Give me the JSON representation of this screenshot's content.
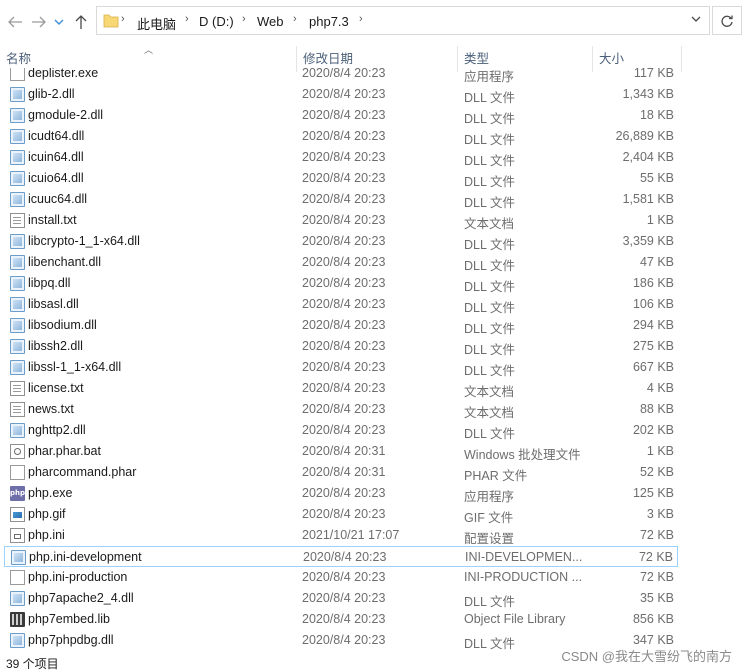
{
  "nav": {
    "breadcrumb": [
      "此电脑",
      "D (D:)",
      "Web",
      "php7.3"
    ]
  },
  "columns": {
    "name": "名称",
    "date": "修改日期",
    "type": "类型",
    "size": "大小"
  },
  "files": [
    {
      "name": "deplister.exe",
      "date": "2020/8/4 20:23",
      "type": "应用程序",
      "size": "117 KB",
      "icon": "exe-icon"
    },
    {
      "name": "glib-2.dll",
      "date": "2020/8/4 20:23",
      "type": "DLL 文件",
      "size": "1,343 KB",
      "icon": "dll-icon"
    },
    {
      "name": "gmodule-2.dll",
      "date": "2020/8/4 20:23",
      "type": "DLL 文件",
      "size": "18 KB",
      "icon": "dll-icon"
    },
    {
      "name": "icudt64.dll",
      "date": "2020/8/4 20:23",
      "type": "DLL 文件",
      "size": "26,889 KB",
      "icon": "dll-icon"
    },
    {
      "name": "icuin64.dll",
      "date": "2020/8/4 20:23",
      "type": "DLL 文件",
      "size": "2,404 KB",
      "icon": "dll-icon"
    },
    {
      "name": "icuio64.dll",
      "date": "2020/8/4 20:23",
      "type": "DLL 文件",
      "size": "55 KB",
      "icon": "dll-icon"
    },
    {
      "name": "icuuc64.dll",
      "date": "2020/8/4 20:23",
      "type": "DLL 文件",
      "size": "1,581 KB",
      "icon": "dll-icon"
    },
    {
      "name": "install.txt",
      "date": "2020/8/4 20:23",
      "type": "文本文档",
      "size": "1 KB",
      "icon": "text-file-icon"
    },
    {
      "name": "libcrypto-1_1-x64.dll",
      "date": "2020/8/4 20:23",
      "type": "DLL 文件",
      "size": "3,359 KB",
      "icon": "dll-icon"
    },
    {
      "name": "libenchant.dll",
      "date": "2020/8/4 20:23",
      "type": "DLL 文件",
      "size": "47 KB",
      "icon": "dll-icon"
    },
    {
      "name": "libpq.dll",
      "date": "2020/8/4 20:23",
      "type": "DLL 文件",
      "size": "186 KB",
      "icon": "dll-icon"
    },
    {
      "name": "libsasl.dll",
      "date": "2020/8/4 20:23",
      "type": "DLL 文件",
      "size": "106 KB",
      "icon": "dll-icon"
    },
    {
      "name": "libsodium.dll",
      "date": "2020/8/4 20:23",
      "type": "DLL 文件",
      "size": "294 KB",
      "icon": "dll-icon"
    },
    {
      "name": "libssh2.dll",
      "date": "2020/8/4 20:23",
      "type": "DLL 文件",
      "size": "275 KB",
      "icon": "dll-icon"
    },
    {
      "name": "libssl-1_1-x64.dll",
      "date": "2020/8/4 20:23",
      "type": "DLL 文件",
      "size": "667 KB",
      "icon": "dll-icon"
    },
    {
      "name": "license.txt",
      "date": "2020/8/4 20:23",
      "type": "文本文档",
      "size": "4 KB",
      "icon": "text-file-icon"
    },
    {
      "name": "news.txt",
      "date": "2020/8/4 20:23",
      "type": "文本文档",
      "size": "88 KB",
      "icon": "text-file-icon"
    },
    {
      "name": "nghttp2.dll",
      "date": "2020/8/4 20:23",
      "type": "DLL 文件",
      "size": "202 KB",
      "icon": "dll-icon"
    },
    {
      "name": "phar.phar.bat",
      "date": "2020/8/4 20:31",
      "type": "Windows 批处理文件",
      "size": "1 KB",
      "icon": "batch-file-icon"
    },
    {
      "name": "pharcommand.phar",
      "date": "2020/8/4 20:31",
      "type": "PHAR 文件",
      "size": "52 KB",
      "icon": "blank-file-icon"
    },
    {
      "name": "php.exe",
      "date": "2020/8/4 20:23",
      "type": "应用程序",
      "size": "125 KB",
      "icon": "php-exe-icon"
    },
    {
      "name": "php.gif",
      "date": "2020/8/4 20:23",
      "type": "GIF 文件",
      "size": "3 KB",
      "icon": "image-file-icon"
    },
    {
      "name": "php.ini",
      "date": "2021/10/21 17:07",
      "type": "配置设置",
      "size": "72 KB",
      "icon": "config-file-icon"
    },
    {
      "name": "php.ini-development",
      "date": "2020/8/4 20:23",
      "type": "INI-DEVELOPMEN...",
      "size": "72 KB",
      "icon": "dll-icon",
      "selected": true
    },
    {
      "name": "php.ini-production",
      "date": "2020/8/4 20:23",
      "type": "INI-PRODUCTION ...",
      "size": "72 KB",
      "icon": "blank-file-icon"
    },
    {
      "name": "php7apache2_4.dll",
      "date": "2020/8/4 20:23",
      "type": "DLL 文件",
      "size": "35 KB",
      "icon": "dll-icon"
    },
    {
      "name": "php7embed.lib",
      "date": "2020/8/4 20:23",
      "type": "Object File Library",
      "size": "856 KB",
      "icon": "library-file-icon"
    },
    {
      "name": "php7phpdbg.dll",
      "date": "2020/8/4 20:23",
      "type": "DLL 文件",
      "size": "347 KB",
      "icon": "dll-icon"
    }
  ],
  "status": {
    "item_count": "39 个项目"
  },
  "watermark": "CSDN @我在大雪纷飞的南方",
  "colors": {
    "header_text": "#4c607a",
    "secondary_text": "#6d6d6d",
    "selection_border": "#99d1ff",
    "folder": "#f8d775"
  }
}
